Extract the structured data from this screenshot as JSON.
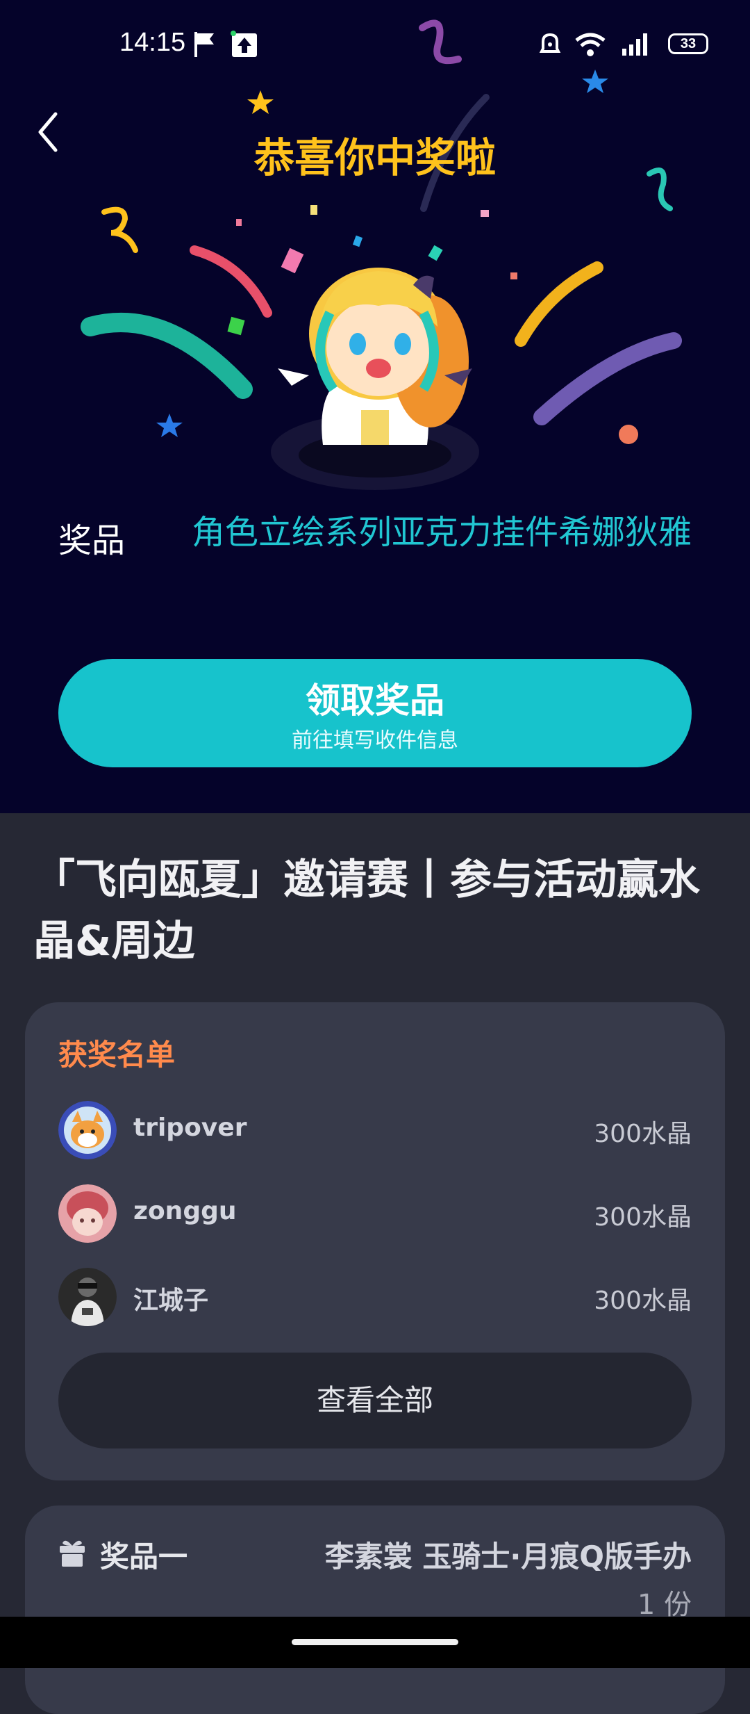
{
  "status_bar": {
    "time": "14:15",
    "battery": "33",
    "icons": [
      "flag-icon",
      "upload-icon",
      "alarm-icon",
      "wifi-icon",
      "signal-icon",
      "battery-icon"
    ]
  },
  "header": {
    "title": "恭喜你中奖啦",
    "back_icon": "chevron-left-icon"
  },
  "prize": {
    "label": "奖品",
    "value": "角色立绘系列亚克力挂件希娜狄雅"
  },
  "claim_button": {
    "title": "领取奖品",
    "subtitle": "前往填写收件信息"
  },
  "event": {
    "title": "「飞向瓯夏」邀请赛丨参与活动赢水晶&周边"
  },
  "winners": {
    "heading": "获奖名单",
    "list": [
      {
        "name": "tripover",
        "prize": "300水晶"
      },
      {
        "name": "zonggu",
        "prize": "300水晶"
      },
      {
        "name": "江城子",
        "prize": "300水晶"
      }
    ],
    "view_all": "查看全部"
  },
  "prize_card": {
    "label": "奖品一",
    "name": "李素裳 玉骑士·月痕Q版手办",
    "quantity": "1 份",
    "icon": "gift-icon"
  },
  "colors": {
    "hero_bg": "#05032a",
    "title_yellow": "#ffc21c",
    "prize_teal": "#21c6d2",
    "button_teal": "#17c3cc",
    "winners_orange": "#ff8a4c",
    "card_bg": "#373a4a"
  }
}
